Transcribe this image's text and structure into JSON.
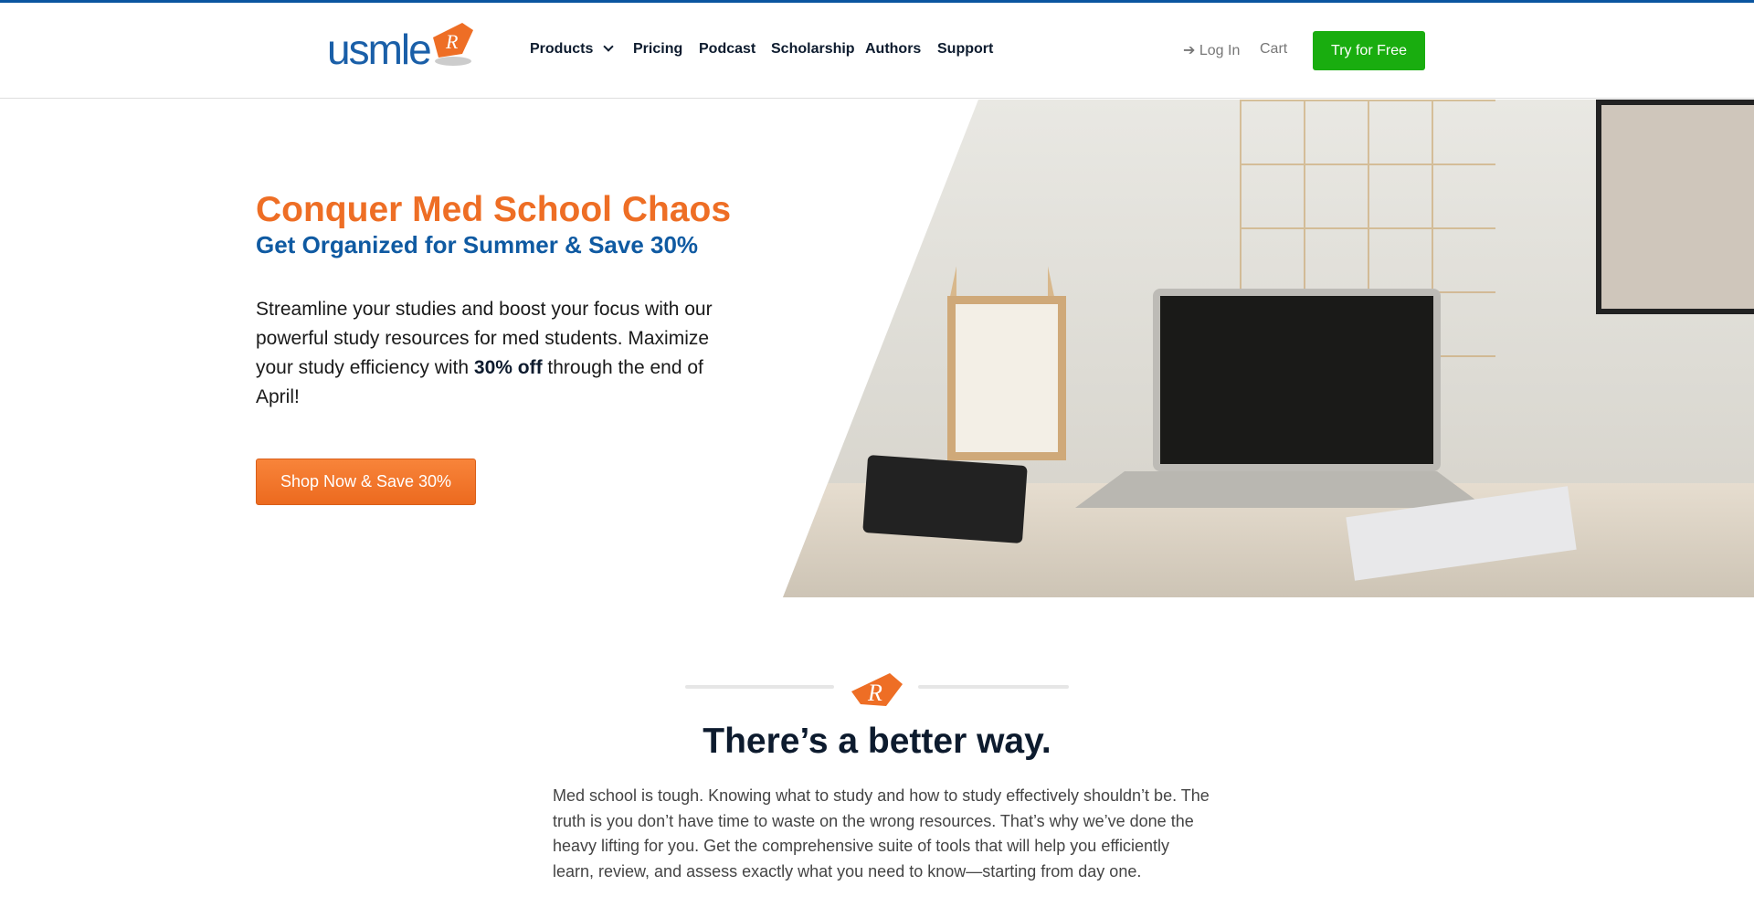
{
  "brand": {
    "logo_text": "usmle",
    "logo_mark": "Rx"
  },
  "nav": {
    "items": [
      {
        "label": "Products",
        "has_dropdown": true
      },
      {
        "label": "Pricing"
      },
      {
        "label": "Podcast"
      },
      {
        "label": "Scholarship"
      },
      {
        "label": "Authors"
      },
      {
        "label": "Support"
      }
    ],
    "login": "Log In",
    "cart": "Cart",
    "try_free": "Try for Free"
  },
  "hero": {
    "title": "Conquer Med School Chaos",
    "subtitle": "Get Organized for Summer & Save 30%",
    "body_before": "Streamline your studies and boost your focus with our powerful study resources for med students. Maximize your study efficiency with ",
    "body_bold": "30% off",
    "body_after": " through the end of April!",
    "cta": "Shop Now & Save 30%"
  },
  "section": {
    "heading": "There’s a better way.",
    "paragraph": "Med school is tough. Knowing what to study and how to study effectively shouldn’t be. The truth is you don’t have time to waste on the wrong resources. That’s why we’ve done the heavy lifting for you. Get the comprehensive suite of tools that will help you efficiently learn, review, and assess exactly what you need to know—starting from day one."
  },
  "colors": {
    "brand_blue": "#0f5aa2",
    "brand_orange": "#ee6e25",
    "cta_green": "#19ad0f"
  }
}
